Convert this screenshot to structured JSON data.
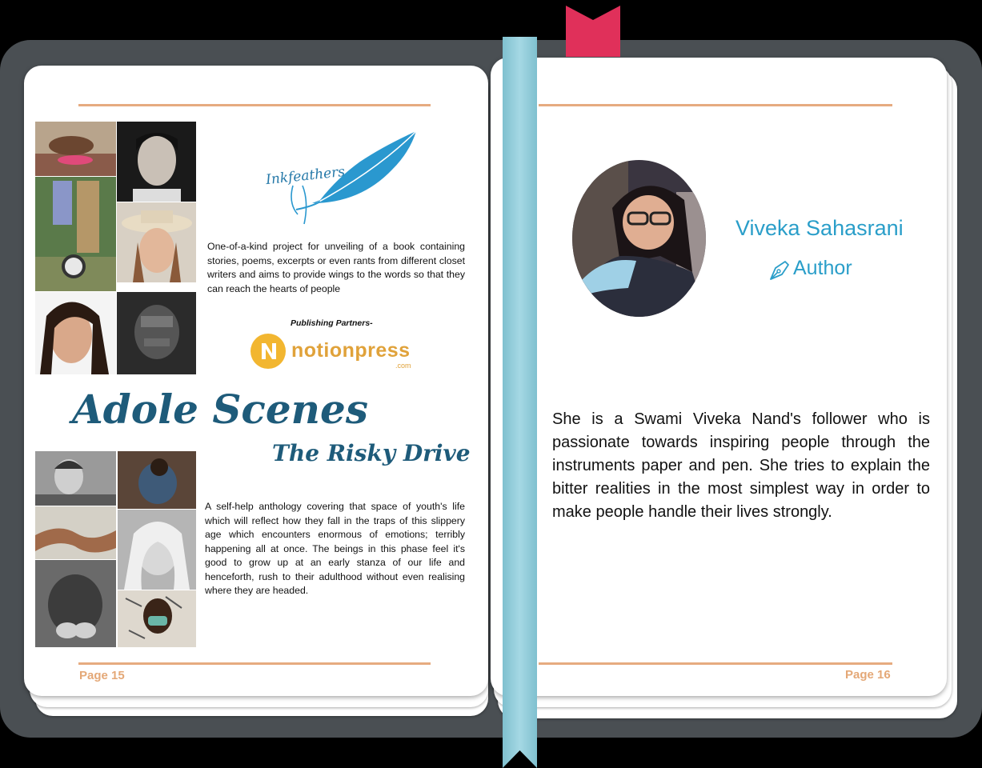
{
  "left_page": {
    "logo_text": "Inkfeathers",
    "intro_text": "One-of-a-kind project for unveiling of a book containing stories, poems, excerpts or even rants from different closet writers and aims to provide wings to the words so that they can reach the hearts of people",
    "publishing_label": "Publishing Partners-",
    "publisher_name": "notionpress",
    "publisher_domain": ".com",
    "title": "Adole Scenes",
    "subtitle": "The Risky Drive",
    "description": "A self-help anthology covering that space of youth's life which will reflect how they fall in the traps of this slippery age which encounters enormous of emotions; terribly happening all at once. The beings in this phase feel it's good to grow up at an early stanza of our life and henceforth, rush to their adulthood without even realising where they are headed.",
    "page_label": "Page 15"
  },
  "right_page": {
    "author_name": "Viveka Sahasrani",
    "author_role": "Author",
    "bio": "She is a Swami Viveka Nand's follower who is passionate towards inspiring people through the instruments paper and pen. She tries to explain the bitter realities in the most simplest way in order to make people handle their lives strongly.",
    "page_label": "Page 16"
  },
  "colors": {
    "frame": "#4a4f53",
    "accent_rule": "#e6ab80",
    "title_blue": "#1e5b7a",
    "author_blue": "#2a9ec9",
    "ribbon": "#8ccbd9",
    "bookmark": "#e0305a",
    "notion_gold": "#f2b630"
  },
  "icons": {
    "feather": "feather-icon",
    "pen": "pen-nib-icon",
    "publisher_logo": "n-circle-logo-icon"
  }
}
